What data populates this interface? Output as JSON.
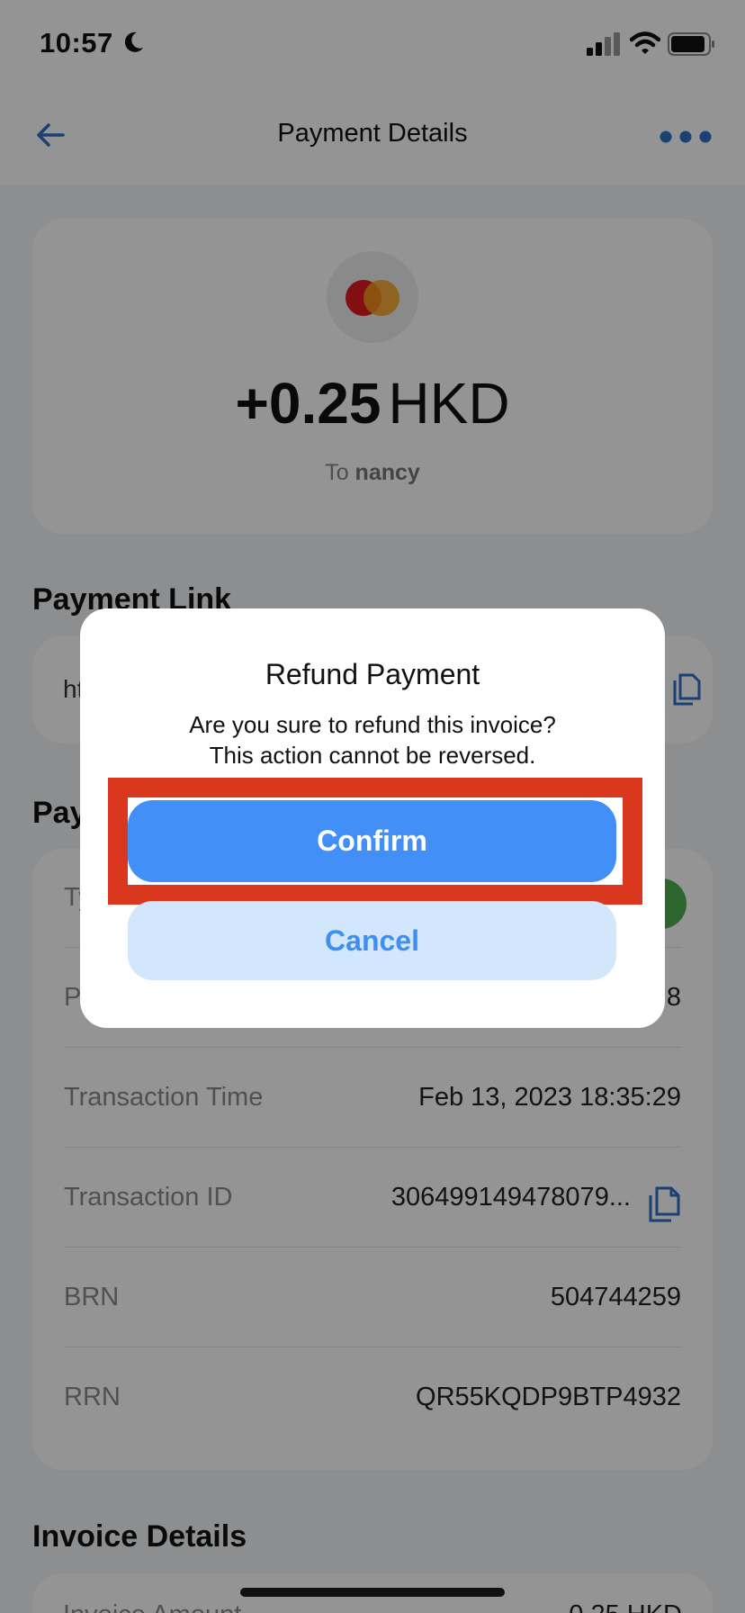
{
  "status_bar": {
    "time": "10:57"
  },
  "nav": {
    "title": "Payment Details"
  },
  "summary": {
    "amount": "+0.25",
    "currency": "HKD",
    "to_prefix": "To",
    "recipient": "nancy"
  },
  "sections": {
    "payment_link": "Payment Link",
    "payment_info_partial": "Pay",
    "invoice_details": "Invoice Details"
  },
  "payment_link": {
    "text_partial": "ht"
  },
  "details": {
    "rows": [
      {
        "label": "Ty",
        "value": ""
      },
      {
        "label": "Pa",
        "value": "8"
      },
      {
        "label": "Transaction Time",
        "value": "Feb 13, 2023 18:35:29"
      },
      {
        "label": "Transaction ID",
        "value": "306499149478079..."
      },
      {
        "label": "BRN",
        "value": "504744259"
      },
      {
        "label": "RRN",
        "value": "QR55KQDP9BTP4932"
      }
    ]
  },
  "invoice": {
    "label_partial": "Invoice Amount",
    "value_partial": "0.25 HKD"
  },
  "modal": {
    "title": "Refund Payment",
    "message_line1": "Are you sure to refund this invoice?",
    "message_line2": "This action cannot be reversed.",
    "confirm_label": "Confirm",
    "cancel_label": "Cancel"
  },
  "colors": {
    "accent": "#418ff7",
    "cancel_bg": "#d2e7fb",
    "highlight": "#d9381e",
    "success": "#4cae4f"
  },
  "icons": [
    "moon-icon",
    "signal-icon",
    "wifi-icon",
    "battery-icon",
    "back-arrow-icon",
    "more-icon",
    "mastercard-icon",
    "copy-icon"
  ]
}
